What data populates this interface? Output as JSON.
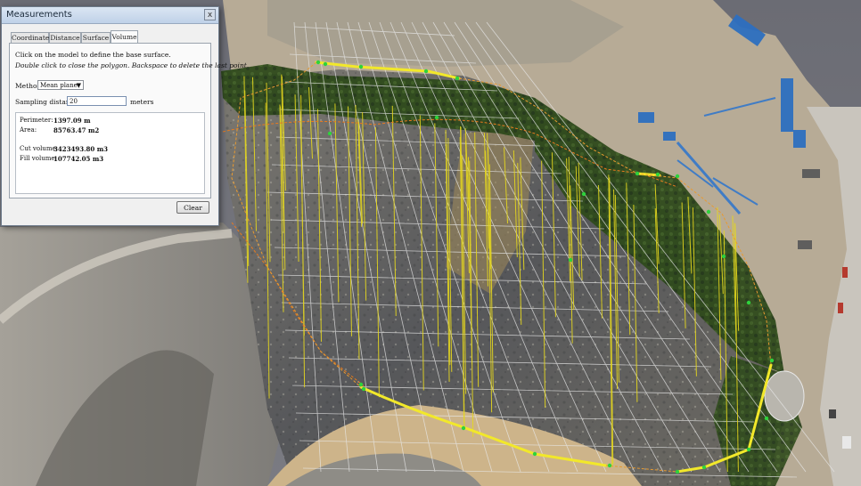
{
  "dialog": {
    "title": "Measurements",
    "close_glyph": "x",
    "tabs": [
      "Coordinate",
      "Distance",
      "Surface",
      "Volume"
    ],
    "active_tab": "Volume",
    "instruction_1": "Click on the model to define the base surface.",
    "instruction_2": "Double click to close the polygon. Backspace to delete the last point.",
    "method_label": "Method:",
    "method_value": "Mean plane",
    "sampling_label": "Sampling distance:",
    "sampling_value": "20",
    "sampling_unit": "meters",
    "results": {
      "perimeter_label": "Perimeter:",
      "perimeter_value": "1397.09 m",
      "area_label": "Area:",
      "area_value": "85763.47 m2",
      "cut_label": "Cut volume:",
      "cut_value": "3423493.80 m3",
      "fill_label": "Fill volume:",
      "fill_value": "107742.05 m3"
    },
    "clear_label": "Clear"
  },
  "colors": {
    "polygon_edge": "#f2e82a",
    "vertex": "#2ed23c",
    "grid": "#e8e8e8",
    "sample_line": "#e6d81e",
    "contour": "#e87a1e",
    "vegetation": "#2f4a1c",
    "rock": "#9a9890",
    "road": "#cdb48a",
    "building_roof": "#2d6fc0"
  }
}
